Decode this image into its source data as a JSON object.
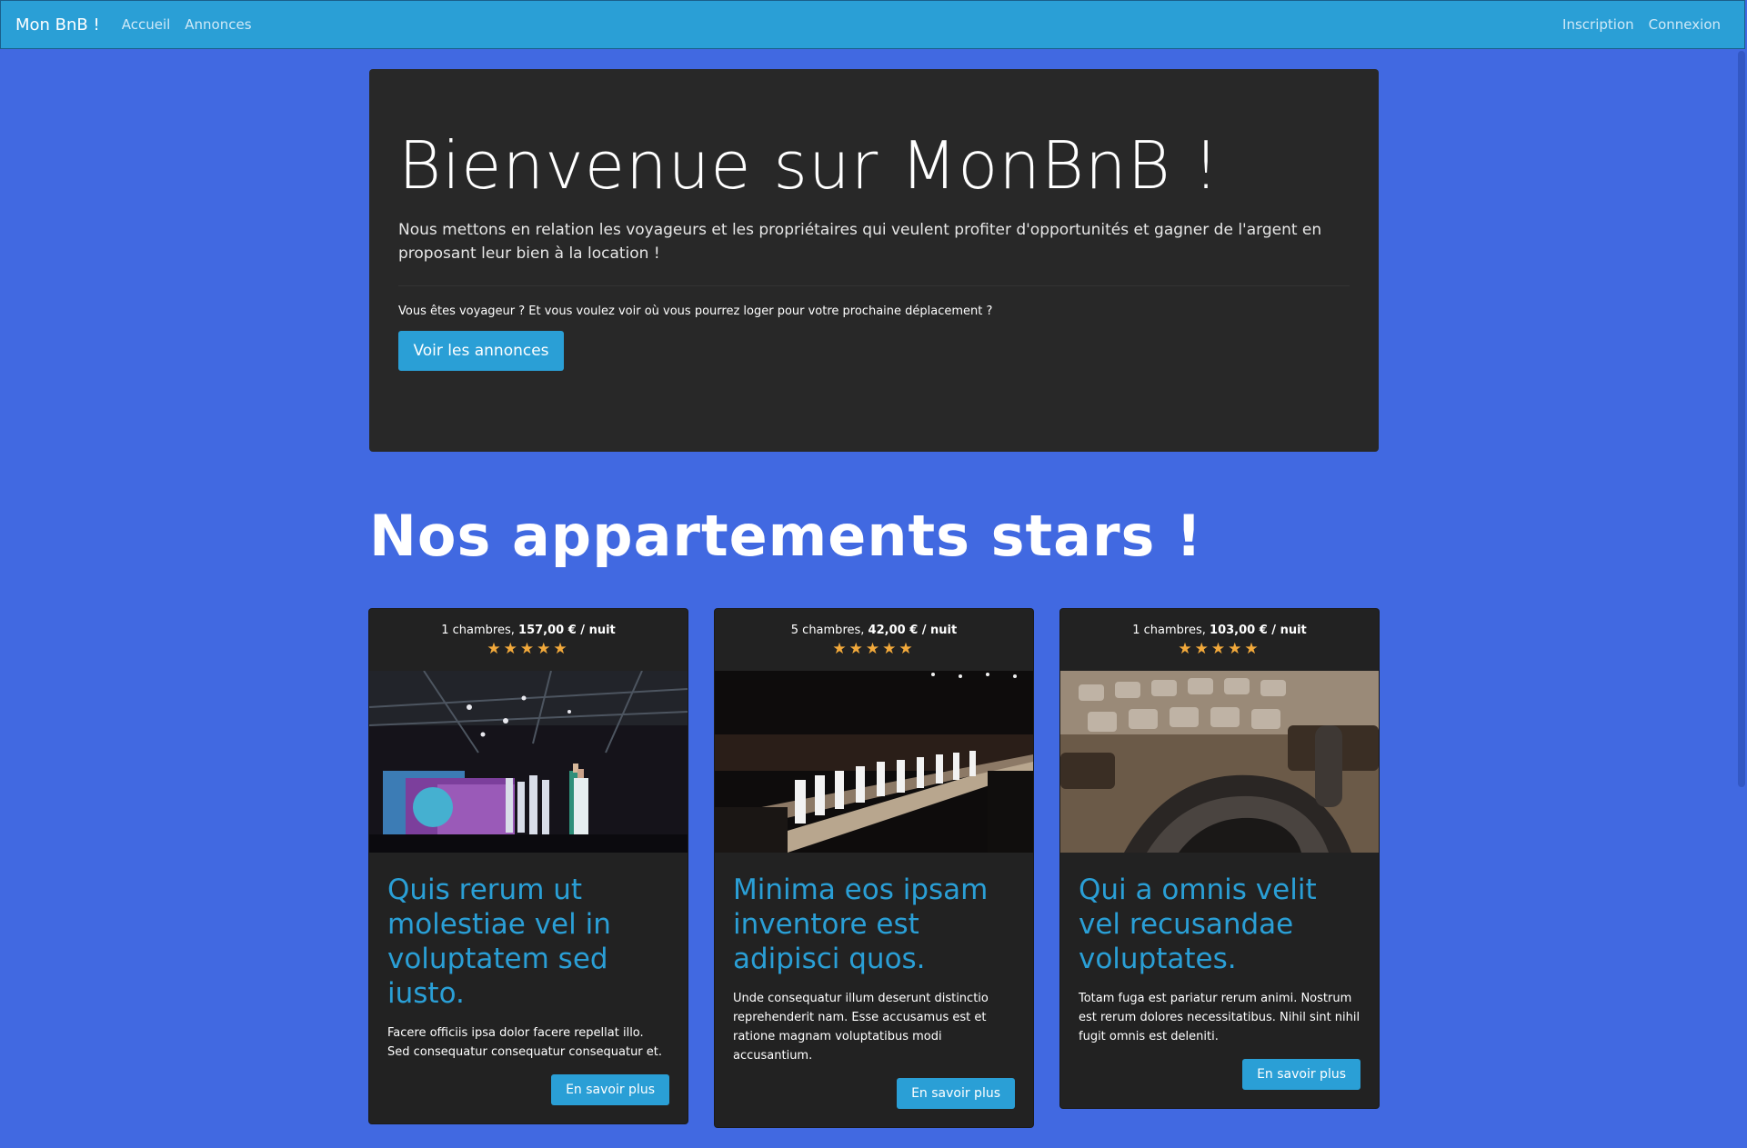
{
  "navbar": {
    "brand": "Mon BnB !",
    "links": [
      "Accueil",
      "Annonces"
    ],
    "right_links": [
      "Inscription",
      "Connexion"
    ]
  },
  "jumbotron": {
    "title": "Bienvenue sur MonBnB !",
    "lead": "Nous mettons en relation les voyageurs et les propriétaires qui veulent profiter d'opportunités et gagner de l'argent en proposant leur bien à la location !",
    "question": "Vous êtes voyageur ? Et vous voulez voir où vous pourrez loger pour votre prochaine déplacement ?",
    "button": "Voir les annonces"
  },
  "section": {
    "title": "Nos appartements stars !"
  },
  "cards": [
    {
      "rooms": "1 chambres,",
      "price": "157,00 € / nuit",
      "stars": "★★★★★",
      "rating": 5,
      "title": "Quis rerum ut molestiae vel in voluptatem sed iusto.",
      "text": "Facere officiis ipsa dolor facere repellat illo. Sed consequatur consequatur consequatur et.",
      "button": "En savoir plus"
    },
    {
      "rooms": "5 chambres,",
      "price": "42,00 € / nuit",
      "stars": "★★★★★",
      "rating": 5,
      "title": "Minima eos ipsam inventore est adipisci quos.",
      "text": "Unde consequatur illum deserunt distinctio reprehenderit nam. Esse accusamus est et ratione magnam voluptatibus modi accusantium.",
      "button": "En savoir plus"
    },
    {
      "rooms": "1 chambres,",
      "price": "103,00 € / nuit",
      "stars": "★★★★★",
      "rating": 5,
      "title": "Qui a omnis velit vel recusandae voluptates.",
      "text": "Totam fuga est pariatur rerum animi. Nostrum est rerum dolores necessitatibus. Nihil sint nihil fugit omnis est deleniti.",
      "button": "En savoir plus"
    }
  ],
  "colors": {
    "page_bg": "#4169e1",
    "navbar_bg": "#2a9fd6",
    "panel_bg": "#282828",
    "card_bg": "#222222",
    "accent": "#2a9fd6",
    "star": "#f2a93b"
  }
}
